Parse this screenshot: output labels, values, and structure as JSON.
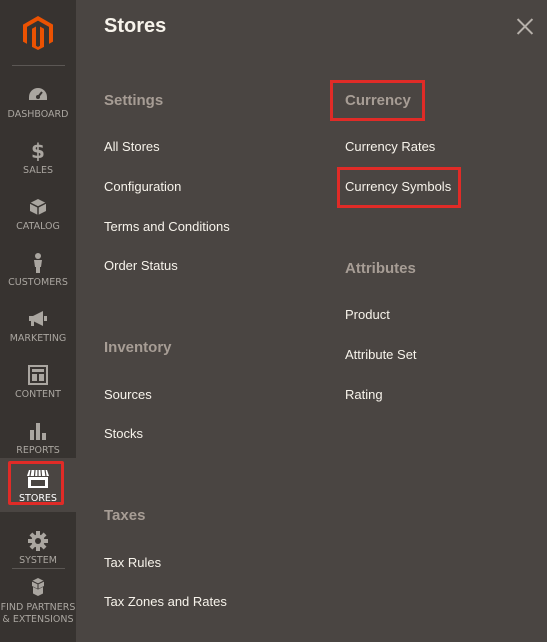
{
  "sidebar": {
    "items": [
      {
        "label": "DASHBOARD",
        "icon": "dashboard-icon"
      },
      {
        "label": "SALES",
        "icon": "dollar-icon"
      },
      {
        "label": "CATALOG",
        "icon": "box-icon"
      },
      {
        "label": "CUSTOMERS",
        "icon": "person-icon"
      },
      {
        "label": "MARKETING",
        "icon": "megaphone-icon"
      },
      {
        "label": "CONTENT",
        "icon": "layout-icon"
      },
      {
        "label": "REPORTS",
        "icon": "bar-chart-icon"
      },
      {
        "label": "STORES",
        "icon": "storefront-icon"
      },
      {
        "label": "SYSTEM",
        "icon": "gear-icon"
      },
      {
        "label_line1": "FIND PARTNERS",
        "label_line2": "& EXTENSIONS",
        "icon": "blocks-icon"
      }
    ]
  },
  "panel": {
    "title": "Stores",
    "settings": {
      "heading": "Settings",
      "links": [
        "All Stores",
        "Configuration",
        "Terms and Conditions",
        "Order Status"
      ]
    },
    "inventory": {
      "heading": "Inventory",
      "links": [
        "Sources",
        "Stocks"
      ]
    },
    "taxes": {
      "heading": "Taxes",
      "links": [
        "Tax Rules",
        "Tax Zones and Rates"
      ]
    },
    "currency": {
      "heading": "Currency",
      "links": [
        "Currency Rates",
        "Currency Symbols"
      ]
    },
    "attributes": {
      "heading": "Attributes",
      "links": [
        "Product",
        "Attribute Set",
        "Rating"
      ]
    }
  },
  "colors": {
    "sidebar_bg": "#373330",
    "panel_bg": "#4a4542",
    "brand_orange": "#eb5202",
    "highlight_red": "#e02b27"
  }
}
